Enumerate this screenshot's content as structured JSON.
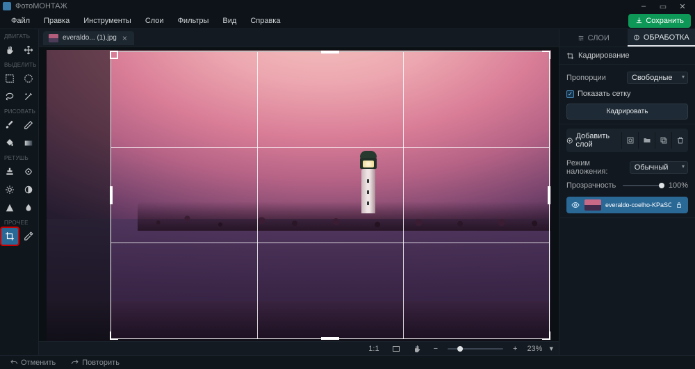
{
  "app": {
    "title": "ФотоМОНТАЖ"
  },
  "window_controls": {
    "min": "–",
    "max": "▭",
    "close": "✕"
  },
  "menu": {
    "file": "Файл",
    "edit": "Правка",
    "tools": "Инструменты",
    "layers": "Слои",
    "filters": "Фильтры",
    "view": "Вид",
    "help": "Справка",
    "save": "Сохранить"
  },
  "tabs": [
    {
      "label": "everaldo... (1).jpg"
    }
  ],
  "tool_sections": {
    "move": "ДВИГАТЬ",
    "select": "ВЫДЕЛИТЬ",
    "draw": "РИСОВАТЬ",
    "retouch": "РЕТУШЬ",
    "other": "ПРОЧЕЕ"
  },
  "status": {
    "ratio": "1:1",
    "zoom": "23%"
  },
  "bottom": {
    "undo": "Отменить",
    "redo": "Повторить"
  },
  "right": {
    "tab_layers": "СЛОИ",
    "tab_processing": "ОБРАБОТКА",
    "crop_header": "Кадрирование",
    "proportions_label": "Пропорции",
    "proportions_value": "Свободные",
    "show_grid": "Показать сетку",
    "crop_button": "Кадрировать",
    "add_layer": "Добавить слой",
    "blend_mode_label": "Режим наложения:",
    "blend_mode_value": "Обычный",
    "opacity_label": "Прозрачность",
    "opacity_value": "100%",
    "layer_name": "everaldo-coelho-KPaSCpklCZw"
  }
}
